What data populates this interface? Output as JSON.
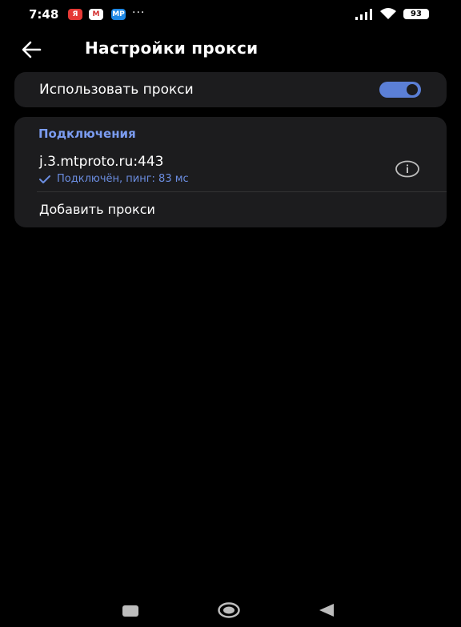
{
  "status_bar": {
    "time": "7:48",
    "notification_icons": [
      "yandex-icon",
      "gmail-icon",
      "app-icon"
    ],
    "badge_ya": "Я",
    "badge_mail": "M",
    "badge_mp": "MP",
    "overflow": "···",
    "battery": "93"
  },
  "appbar": {
    "title": "Настройки прокси",
    "back_icon": "arrow-left-icon"
  },
  "proxy_toggle": {
    "label": "Использовать прокси",
    "enabled": true,
    "accent_color": "#5b7fd6"
  },
  "connections": {
    "section_title": "Подключения",
    "section_color": "#7b9cf0",
    "items": [
      {
        "host": "j.3.mtproto.ru:443",
        "status": "Подключён, пинг: 83 мс",
        "status_icon": "check-icon",
        "action_icon": "info-icon"
      }
    ],
    "add_label": "Добавить прокси"
  },
  "nav_bar": {
    "buttons": [
      "recent-apps",
      "home",
      "back"
    ]
  }
}
